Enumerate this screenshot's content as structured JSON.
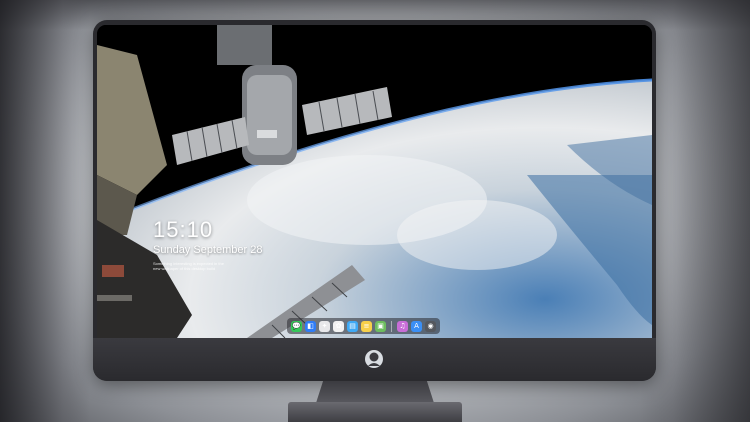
{
  "lock_screen": {
    "time": "15:10",
    "date": "Sunday September 28",
    "note_line1": "Something interesting is expected in the",
    "note_line2": "new wallpaper of this desktop build"
  },
  "dock": {
    "apps": [
      {
        "name": "messages-icon",
        "glyph": "💬",
        "color": "#35c759"
      },
      {
        "name": "finder-icon",
        "glyph": "◧",
        "color": "#2f7cf6"
      },
      {
        "name": "safari-icon",
        "glyph": "✦",
        "color": "#e8e8ea"
      },
      {
        "name": "photos-icon",
        "glyph": "✿",
        "color": "#f2f2f2"
      },
      {
        "name": "clapper-icon",
        "glyph": "▤",
        "color": "#3fa9f5"
      },
      {
        "name": "notes-icon",
        "glyph": "≡",
        "color": "#f7d04a"
      },
      {
        "name": "preview-icon",
        "glyph": "▣",
        "color": "#6dbd5f"
      }
    ],
    "extras": [
      {
        "name": "music-icon",
        "glyph": "♫",
        "color": "#c86dd7"
      },
      {
        "name": "app-store-icon",
        "glyph": "A",
        "color": "#3b8ff5"
      },
      {
        "name": "camera-icon",
        "glyph": "◉",
        "color": "#55585e"
      }
    ]
  },
  "colors": {
    "bezel": "#2a2a2e",
    "space": "#000000",
    "earth_cloud": "#e6e8ea",
    "earth_ocean": "#3a6fa6"
  }
}
